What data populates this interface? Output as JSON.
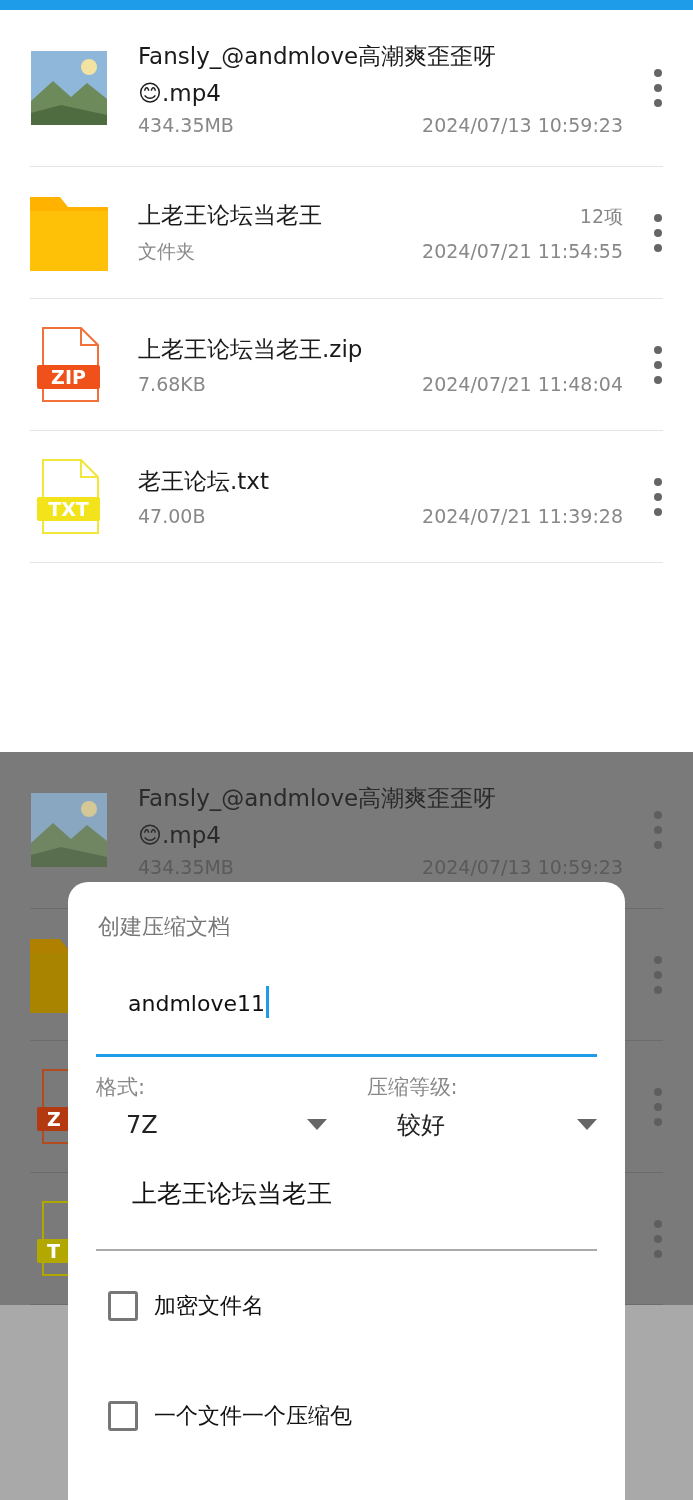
{
  "files": [
    {
      "kind": "video",
      "name_line1": "Fansly_@andmlove高潮爽歪歪呀",
      "name_line2": "😊.mp4",
      "size": "434.35MB",
      "date": "2024/07/13 10:59:23"
    },
    {
      "kind": "folder",
      "name_line1": "上老王论坛当老王",
      "count": "12项",
      "size": "文件夹",
      "date": "2024/07/21 11:54:55"
    },
    {
      "kind": "zip",
      "badge": "ZIP",
      "name_line1": "上老王论坛当老王.zip",
      "size": "7.68KB",
      "date": "2024/07/21 11:48:04"
    },
    {
      "kind": "txt",
      "badge": "TXT",
      "name_line1": "老王论坛.txt",
      "size": "47.00B",
      "date": "2024/07/21 11:39:28"
    }
  ],
  "background_files": [
    {
      "kind": "video",
      "name_line1": "Fansly_@andmlove高潮爽歪歪呀",
      "name_line2": "😊.mp4",
      "size": "434.35MB",
      "date": "2024/07/13 10:59:23"
    },
    {
      "kind": "folder"
    },
    {
      "kind": "zip",
      "badge": "Z"
    },
    {
      "kind": "txt",
      "badge": "T"
    }
  ],
  "dialog": {
    "title": "创建压缩文档",
    "archive_name": "andmlove11",
    "format_label": "格式:",
    "format_value": "7Z",
    "level_label": "压缩等级:",
    "level_value": "较好",
    "source": "上老王论坛当老王",
    "options": [
      {
        "label": "加密文件名",
        "checked": false
      },
      {
        "label": "一个文件一个压缩包",
        "checked": false
      }
    ]
  }
}
